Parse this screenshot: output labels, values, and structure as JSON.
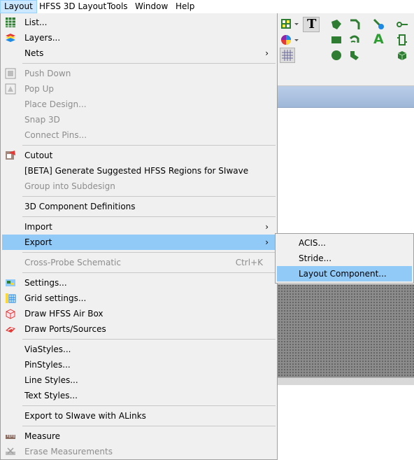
{
  "menubar": {
    "items": [
      {
        "label": "Layout",
        "active": true
      },
      {
        "label": "HFSS 3D Layout"
      },
      {
        "label": "Tools"
      },
      {
        "label": "Window"
      },
      {
        "label": "Help"
      }
    ]
  },
  "layout_menu": {
    "list": "List...",
    "layers": "Layers...",
    "nets": "Nets",
    "push_down": "Push Down",
    "pop_up": "Pop Up",
    "place_design": "Place Design...",
    "snap_3d": "Snap 3D",
    "connect_pins": "Connect Pins...",
    "cutout": "Cutout",
    "generate_regions": "[BETA] Generate Suggested HFSS Regions for SIwave",
    "group_subdesign": "Group into Subdesign",
    "component_defs": "3D Component Definitions",
    "import": "Import",
    "export": "Export",
    "cross_probe": "Cross-Probe Schematic",
    "cross_probe_accel": "Ctrl+K",
    "settings": "Settings...",
    "grid_settings": "Grid settings...",
    "draw_air_box": "Draw HFSS Air Box",
    "draw_ports": "Draw Ports/Sources",
    "via_styles": "ViaStyles...",
    "pin_styles": "PinStyles...",
    "line_styles": "Line Styles...",
    "text_styles": "Text Styles...",
    "export_siwave": "Export to SIwave with ALinks",
    "measure": "Measure",
    "erase_measurements": "Erase Measurements",
    "submenu_arrow": "›"
  },
  "export_submenu": {
    "acis": "ACIS...",
    "stride": "Stride...",
    "layout_component": "Layout Component..."
  },
  "toolbar": {
    "text_tool_glyph": "T",
    "annotation_glyph": "A"
  }
}
